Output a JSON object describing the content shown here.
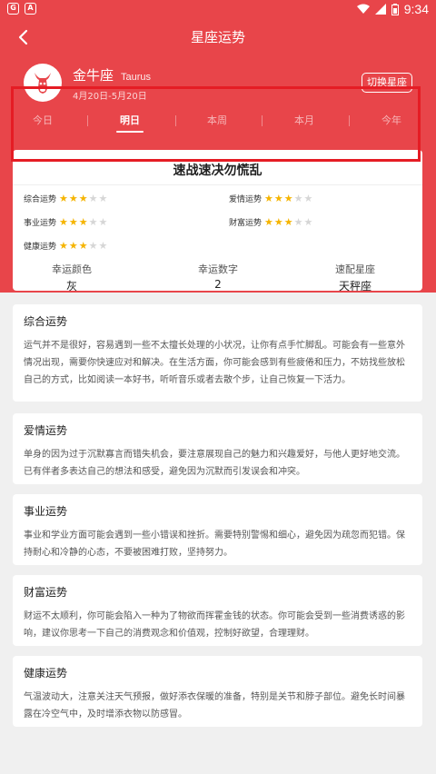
{
  "status": {
    "time": "9:34"
  },
  "nav": {
    "title": "星座运势"
  },
  "sign": {
    "name": "金牛座",
    "name_en": "Taurus",
    "dates": "4月20日-5月20日",
    "switch_label": "切换星座"
  },
  "tabs": [
    {
      "label": "今日",
      "active": false
    },
    {
      "label": "明日",
      "active": true
    },
    {
      "label": "本周",
      "active": false
    },
    {
      "label": "本月",
      "active": false
    },
    {
      "label": "今年",
      "active": false
    }
  ],
  "headline": "速战速决勿慌乱",
  "ratings": [
    {
      "label": "综合运势",
      "stars": 3,
      "max": 5
    },
    {
      "label": "爱情运势",
      "stars": 3,
      "max": 5
    },
    {
      "label": "事业运势",
      "stars": 3,
      "max": 5
    },
    {
      "label": "财富运势",
      "stars": 3,
      "max": 5
    },
    {
      "label": "健康运势",
      "stars": 3,
      "max": 5
    }
  ],
  "lucky": [
    {
      "label": "幸运颜色",
      "value": "灰"
    },
    {
      "label": "幸运数字",
      "value": "2"
    },
    {
      "label": "速配星座",
      "value": "天秤座"
    }
  ],
  "sections": [
    {
      "title": "综合运势",
      "text": "运气并不是很好，容易遇到一些不太擅长处理的小状况，让你有点手忙脚乱。可能会有一些意外情况出现，需要你快速应对和解决。在生活方面，你可能会感到有些疲倦和压力，不妨找些放松自己的方式，比如阅读一本好书，听听音乐或者去散个步，让自己恢复一下活力。"
    },
    {
      "title": "爱情运势",
      "text": "单身的因为过于沉默寡言而错失机会，要注意展现自己的魅力和兴趣爱好，与他人更好地交流。已有伴者多表达自己的想法和感受，避免因为沉默而引发误会和冲突。"
    },
    {
      "title": "事业运势",
      "text": "事业和学业方面可能会遇到一些小错误和挫折。需要特别警惕和细心，避免因为疏忽而犯错。保持耐心和冷静的心态，不要被困难打败，坚持努力。"
    },
    {
      "title": "财富运势",
      "text": "财运不太顺利，你可能会陷入一种为了物欲而挥霍金钱的状态。你可能会受到一些消费诱惑的影响，建议你思考一下自己的消费观念和价值观，控制好欲望，合理理财。"
    },
    {
      "title": "健康运势",
      "text": "气温波动大，注意关注天气预报，做好添衣保暖的准备，特别是关节和脖子部位。避免长时间暴露在冷空气中，及时增添衣物以防感冒。"
    }
  ],
  "colors": {
    "header": "#e8454a",
    "highlight_outline": "#e51c24",
    "star_on": "#f5b400",
    "star_off": "#d6d6d6"
  }
}
